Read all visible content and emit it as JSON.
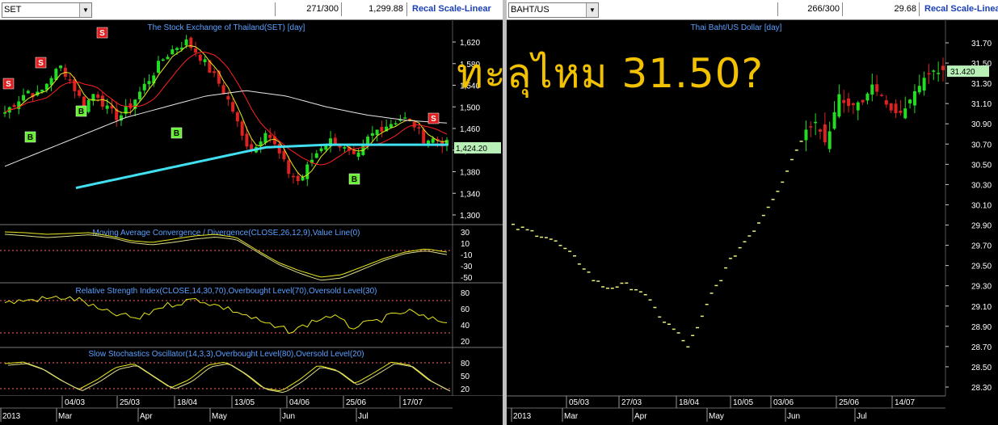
{
  "left": {
    "symbol": "SET",
    "counter": "271/300",
    "last": "1,299.88",
    "recal": "Recal Scale-Linear",
    "title": "The Stock Exchange of Thailand(SET) [day]",
    "price_axis": [
      "1,620",
      "1,580",
      "1,540",
      "1,500",
      "1,460",
      "1,420",
      "1,380",
      "1,340",
      "1,300"
    ],
    "last_label": "1,424.20",
    "macd_title": "Moving Average Convergence / Divergence(CLOSE,26,12,9),Value Line(0)",
    "macd_axis": [
      "30",
      "10",
      "-10",
      "-30",
      "-50"
    ],
    "rsi_title": "Relative Strength Index(CLOSE,14,30,70),Overbought Level(70),Oversold Level(30)",
    "rsi_axis": [
      "80",
      "60",
      "40",
      "20"
    ],
    "stoch_title": "Slow Stochastics Oscillator(14,3,3),Overbought Level(80),Oversold Level(20)",
    "stoch_axis": [
      "80",
      "50",
      "20"
    ],
    "date_ticks": [
      "04/03",
      "25/03",
      "18/04",
      "13/05",
      "04/06",
      "25/06",
      "17/07"
    ],
    "month_labels": [
      "2013",
      "Mar",
      "Apr",
      "May",
      "Jun",
      "Jul"
    ],
    "signals": [
      "S",
      "S",
      "S",
      "S",
      "S",
      "B",
      "B",
      "B",
      "B",
      "B"
    ]
  },
  "right": {
    "symbol": "BAHT/US",
    "counter": "266/300",
    "last": "29.68",
    "recal": "Recal Scale-Linea",
    "title": "Thai Baht/US Dollar [day]",
    "price_axis": [
      "31.70",
      "31.50",
      "31.30",
      "31.10",
      "30.90",
      "30.70",
      "30.50",
      "30.30",
      "30.10",
      "29.90",
      "29.70",
      "29.50",
      "29.30",
      "29.10",
      "28.90",
      "28.70",
      "28.50",
      "28.30"
    ],
    "last_label": "31.420",
    "date_ticks": [
      "05/03",
      "27/03",
      "18/04",
      "10/05",
      "03/06",
      "25/06",
      "14/07"
    ],
    "month_labels": [
      "2013",
      "Mar",
      "Apr",
      "May",
      "Jun",
      "Jul"
    ]
  },
  "annotation": "ทะลุไหม 31.50?",
  "colors": {
    "up": "#22dd22",
    "down": "#dd2222",
    "ma_long": "#40e0f0",
    "ma_mid": "#e8e8e8",
    "ma_red": "#ff2020",
    "ma_yellow": "#e8e820",
    "annotation": "#f2c200",
    "axis_text": "#ffffff",
    "title_text": "#5aa0ff",
    "dotted": "#ff6060"
  },
  "chart_data": [
    {
      "type": "candlestick",
      "title": "The Stock Exchange of Thailand(SET) [day]",
      "ylim": [
        1300,
        1640
      ],
      "x": [
        "04/03",
        "25/03",
        "18/04",
        "13/05",
        "04/06",
        "25/06",
        "17/07"
      ],
      "close": [
        1520,
        1530,
        1480,
        1600,
        1400,
        1380,
        1424.2
      ],
      "last": 1424.2
    },
    {
      "type": "line",
      "title": "Moving Average Convergence / Divergence(CLOSE,26,12,9),Value Line(0)",
      "ylim": [
        -50,
        30
      ]
    },
    {
      "type": "line",
      "title": "Relative Strength Index(CLOSE,14,30,70),Overbought Level(70),Oversold Level(30)",
      "ylim": [
        20,
        80
      ]
    },
    {
      "type": "line",
      "title": "Slow Stochastics Oscillator(14,3,3),Overbought Level(80),Oversold Level(20)",
      "ylim": [
        20,
        80
      ]
    },
    {
      "type": "candlestick",
      "title": "Thai Baht/US Dollar [day]",
      "ylim": [
        28.3,
        31.7
      ],
      "x": [
        "05/03",
        "27/03",
        "18/04",
        "10/05",
        "03/06",
        "25/06",
        "14/07"
      ],
      "close": [
        29.7,
        29.3,
        28.8,
        29.6,
        30.5,
        31.1,
        31.42
      ],
      "last": 31.42
    }
  ]
}
